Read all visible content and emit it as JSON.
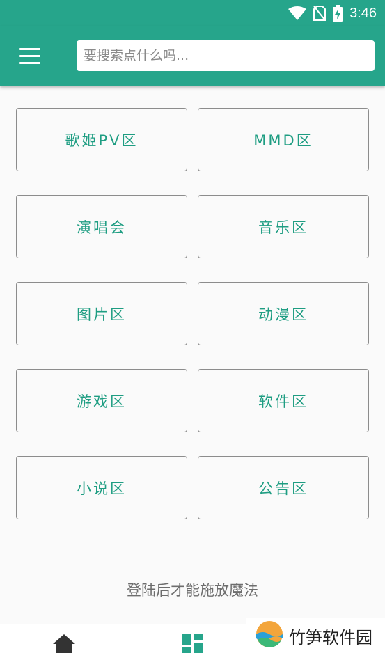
{
  "status_bar": {
    "time": "3:46",
    "icons": [
      "wifi-icon",
      "no-sim-icon",
      "battery-charging-icon"
    ]
  },
  "app_bar": {
    "menu_icon": "hamburger-menu-icon",
    "search_placeholder": "要搜索点什么吗..."
  },
  "categories": [
    {
      "label": "歌姬PV区"
    },
    {
      "label": "MMD区"
    },
    {
      "label": "演唱会"
    },
    {
      "label": "音乐区"
    },
    {
      "label": "图片区"
    },
    {
      "label": "动漫区"
    },
    {
      "label": "游戏区"
    },
    {
      "label": "软件区"
    },
    {
      "label": "小说区"
    },
    {
      "label": "公告区"
    }
  ],
  "login_hint": "登陆后才能施放魔法",
  "bottom_nav": {
    "items": [
      {
        "icon": "home-icon"
      },
      {
        "icon": "dashboard-icon"
      }
    ]
  },
  "watermark": {
    "text": "竹笋软件园",
    "icon": "logo-icon"
  },
  "colors": {
    "primary": "#26a58b",
    "accent_text": "#1e9d82",
    "background": "#fafafa"
  }
}
